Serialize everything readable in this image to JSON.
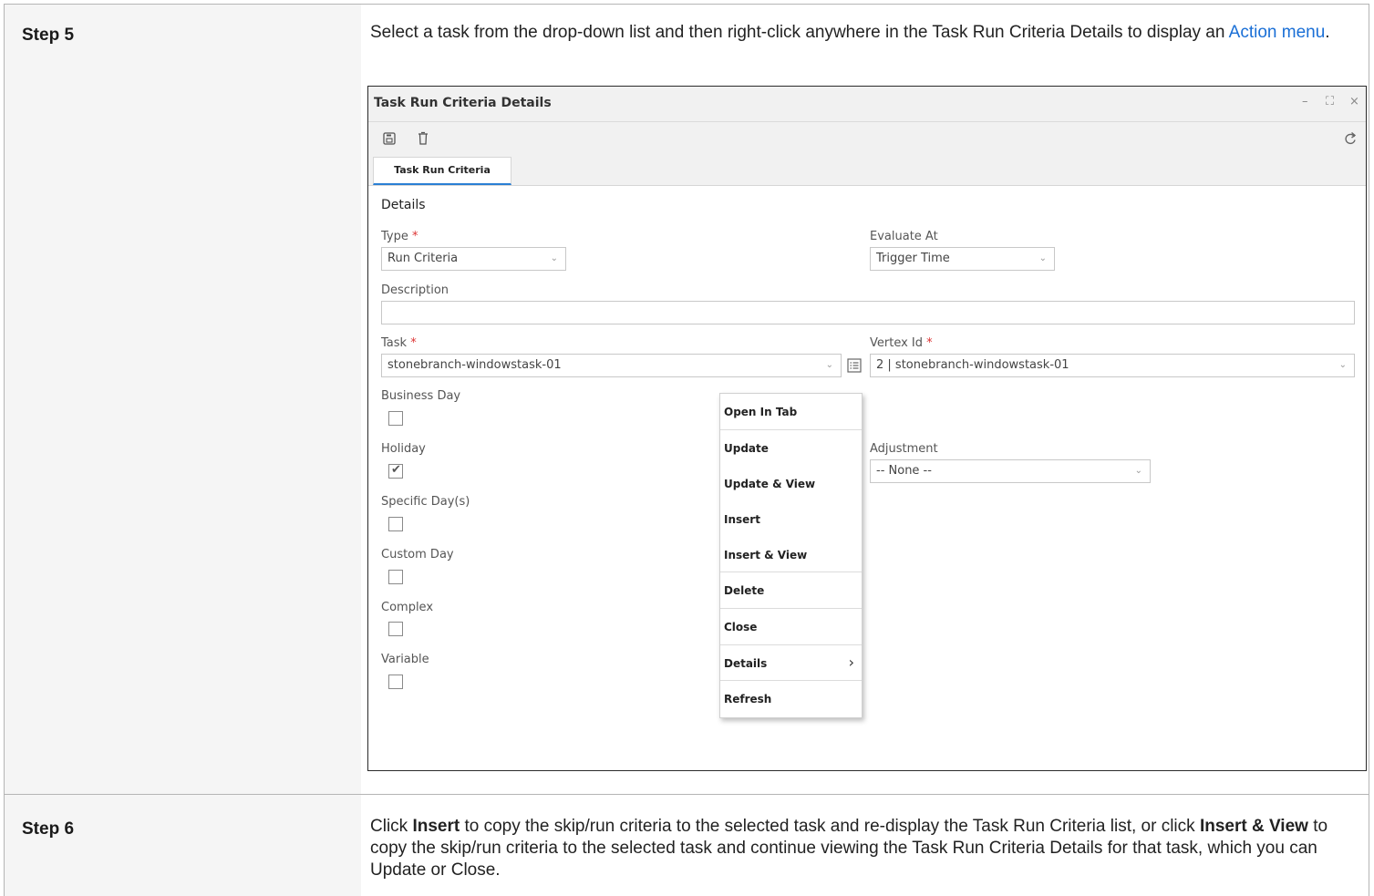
{
  "step5": {
    "label": "Step 5",
    "text_before_link": "Select a task from the drop-down list and then right-click anywhere in the Task Run Criteria Details to display an ",
    "link_text": "Action menu",
    "text_after_link": "."
  },
  "window": {
    "title": "Task Run Criteria Details",
    "controls": {
      "minimize": "–",
      "maximize": "⛶",
      "close": "×"
    },
    "tab": "Task Run Criteria",
    "section": "Details",
    "type_label": "Type",
    "type_value": "Run Criteria",
    "evaluate_label": "Evaluate At",
    "evaluate_value": "Trigger Time",
    "description_label": "Description",
    "task_label": "Task",
    "task_value": "stonebranch-windowstask-01",
    "vertex_label": "Vertex Id",
    "vertex_value": "2 | stonebranch-windowstask-01",
    "required_mark": "*",
    "checkboxes": [
      {
        "label": "Business Day",
        "checked": false
      },
      {
        "label": "Holiday",
        "checked": true
      },
      {
        "label": "Specific Day(s)",
        "checked": false
      },
      {
        "label": "Custom Day",
        "checked": false
      },
      {
        "label": "Complex",
        "checked": false
      },
      {
        "label": "Variable",
        "checked": false
      }
    ],
    "adjustment_label": "Adjustment",
    "adjustment_value": "-- None --",
    "context_menu": [
      "Open In Tab",
      "Update",
      "Update & View",
      "Insert",
      "Insert & View",
      "Delete",
      "Close",
      "Details",
      "Refresh"
    ],
    "icons": [
      "save-icon",
      "trash-icon",
      "refresh-icon",
      "list-icon"
    ]
  },
  "step6": {
    "label": "Step 6",
    "t1": "Click ",
    "b1": "Insert",
    "t2": " to copy the skip/run criteria to the selected task and re-display the Task Run Criteria list, or click ",
    "b2": "Insert & View",
    "t3": " to copy the skip/run criteria to the selected task and continue viewing the Task Run Criteria Details for that task, which you can Update or Close."
  }
}
